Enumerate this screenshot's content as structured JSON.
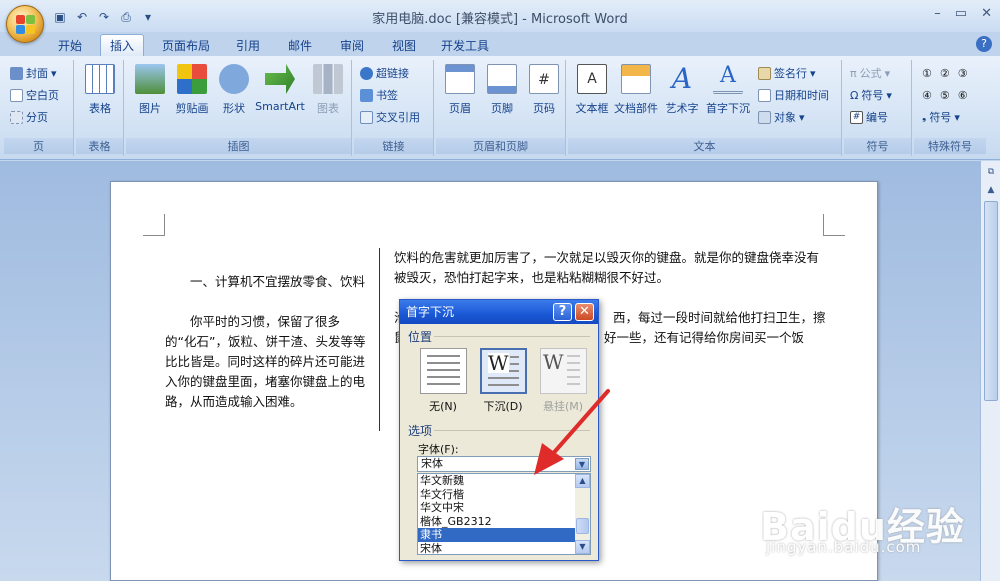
{
  "window": {
    "title": "家用电脑.doc [兼容模式] - Microsoft Word"
  },
  "tabs": [
    "开始",
    "插入",
    "页面布局",
    "引用",
    "邮件",
    "审阅",
    "视图",
    "开发工具"
  ],
  "active_tab": "插入",
  "ribbon": {
    "page_group": {
      "label": "页",
      "items": [
        "封面",
        "空白页",
        "分页"
      ]
    },
    "table_group": {
      "label": "表格",
      "items": [
        "表格"
      ]
    },
    "illustration_group": {
      "label": "插图",
      "items": [
        "图片",
        "剪贴画",
        "形状",
        "SmartArt",
        "图表"
      ]
    },
    "links_group": {
      "label": "链接",
      "items": [
        "超链接",
        "书签",
        "交叉引用"
      ]
    },
    "headerfooter_group": {
      "label": "页眉和页脚",
      "items": [
        "页眉",
        "页脚",
        "页码"
      ]
    },
    "text_group": {
      "label": "文本",
      "items": [
        "文本框",
        "文档部件",
        "艺术字",
        "首字下沉",
        "签名行",
        "日期和时间",
        "对象"
      ]
    },
    "symbol_group": {
      "label": "符号",
      "items": [
        "公式",
        "符号",
        "编号"
      ]
    },
    "special_group": {
      "label": "特殊符号",
      "items": [
        "①",
        "②",
        "③",
        "④",
        "⑤",
        "⑥",
        "符号"
      ]
    }
  },
  "document": {
    "col1_heading": "一、计算机不宜摆放零食、饮料",
    "col1_body": "你平时的习惯，保留了很多的“化石”，饭粒、饼干渣、头发等等比比皆是。同时这样的碎片还可能进入你的键盘里面，堵塞你键盘上的电路，从而造成输入困难。",
    "col2_p1": "饮料的危害就更加厉害了，一次就足以毁灭你的键盘。就是你的键盘侥幸没有被毁灭，恐怕打起字来，也是粘粘糊糊很不好过。",
    "col2_p2_start": "滑",
    "col2_p2_tail": "西，每过一段时间就给他打扫卫生，擦",
    "col2_p3_start": "鼠",
    "col2_p3_tail": "好一些，还有记得给你房间买一个饭"
  },
  "dialog": {
    "title": "首字下沉",
    "position_label": "位置",
    "positions": [
      "无(N)",
      "下沉(D)",
      "悬挂(M)"
    ],
    "options_label": "选项",
    "font_label": "字体(F):",
    "font_value": "宋体",
    "font_list": [
      "华文新魏",
      "华文行楷",
      "华文中宋",
      "楷体_GB2312",
      "隶书",
      "宋体"
    ],
    "selected_font": "隶书"
  },
  "watermark": {
    "text": "Baidu经验",
    "sub": "jingyan.baidu.com"
  },
  "colors": {
    "accent": "#15428b",
    "selection": "#316ac5",
    "arrow": "#e02b2b"
  }
}
